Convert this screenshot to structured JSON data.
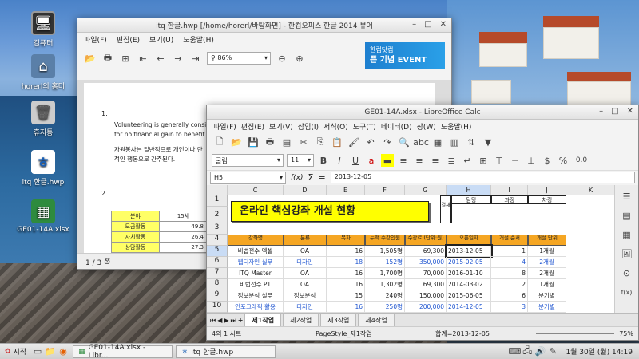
{
  "desktop": {
    "icons": [
      {
        "label": "컴퓨터"
      },
      {
        "label": "horerl의 홈더"
      },
      {
        "label": "휴지통"
      },
      {
        "label": "itq 한글.hwp"
      },
      {
        "label": "GE01-14A.xlsx"
      }
    ]
  },
  "hwp": {
    "title": "itq 한글.hwp [/home/horerl/바탕화면] - 한컴오피스 한글 2014 뷰어",
    "menu": [
      "파일(F)",
      "편집(E)",
      "보기(U)",
      "도움말(H)"
    ],
    "zoom": "86%",
    "ad_line1": "한컴닷컴",
    "ad_line2": "픈 기념 EVENT",
    "doc": {
      "item1_num": "1.",
      "item1_line1": "Volunteering is generally conside",
      "item1_line2": "for no financial gain to benefit",
      "item1_kor1": "자원봉사는 일반적으로 개인이나 단",
      "item1_kor2": "적인 행동으로 간주된다.",
      "item2_num": "2.",
      "table": [
        [
          "분야",
          "15세"
        ],
        [
          "모금활동",
          "49.8"
        ],
        [
          "자치활동",
          "26.4"
        ],
        [
          "상담활동",
          "27.3"
        ]
      ]
    },
    "status": "1 / 3 쪽"
  },
  "calc": {
    "title": "GE01-14A.xlsx - LibreOffice Calc",
    "menu": [
      "파일(F)",
      "편집(E)",
      "보기(V)",
      "삽입(I)",
      "서식(O)",
      "도구(T)",
      "데이터(D)",
      "창(W)",
      "도움말(H)"
    ],
    "font_name": "굴림",
    "font_size": "11",
    "cell_ref": "H5",
    "formula_value": "2013-12-05",
    "columns": [
      "C",
      "D",
      "E",
      "F",
      "G",
      "H",
      "I",
      "J",
      "K"
    ],
    "rows": [
      "1",
      "2",
      "3",
      "4",
      "5",
      "6",
      "7",
      "8",
      "9",
      "10"
    ],
    "banner_title": "온라인 핵심강좌 개설 현황",
    "approval": {
      "side": "결재",
      "h1": "담당",
      "h2": "과장",
      "h3": "차장"
    },
    "headers": [
      "강좌명",
      "분류",
      "목차",
      "누적 수강인원",
      "수강료 (단위:원)",
      "오픈일자",
      "개설 순서",
      "개설 단위"
    ],
    "data_rows": [
      [
        "비법전수 엑셀",
        "OA",
        "16",
        "1,505명",
        "69,300",
        "2013-12-05",
        "1",
        "1개월"
      ],
      [
        "웹디자인 실무",
        "디자인",
        "18",
        "152명",
        "350,000",
        "2015-02-05",
        "4",
        "2개월"
      ],
      [
        "ITQ Master",
        "OA",
        "16",
        "1,700명",
        "70,000",
        "2016-01-10",
        "8",
        "2개월"
      ],
      [
        "비법전수 PT",
        "OA",
        "16",
        "1,302명",
        "69,300",
        "2014-03-02",
        "2",
        "1개월"
      ],
      [
        "정보분석 실무",
        "정보분석",
        "15",
        "240명",
        "150,000",
        "2015-06-05",
        "6",
        "분기별"
      ],
      [
        "인포그래픽 활용",
        "디자인",
        "16",
        "250명",
        "200,000",
        "2014-12-05",
        "3",
        "분기별"
      ]
    ],
    "tabs": [
      "제1작업",
      "제2작업",
      "제3작업",
      "제4작업"
    ],
    "status_sheet": "4의 1 시트",
    "status_style": "PageStyle_제1작업",
    "status_sum": "합계=2013-12-05",
    "status_zoom": "75%"
  },
  "taskbar": {
    "start": "시작",
    "task1": "GE01-14A.xlsx - Libr...",
    "task2": "itq 한글.hwp",
    "clock": "1월 30일 (월) 14:19"
  },
  "colors": {
    "banner_yellow": "#ffff00",
    "header_orange": "#f5a623",
    "blue_text": "#1f55d0"
  }
}
